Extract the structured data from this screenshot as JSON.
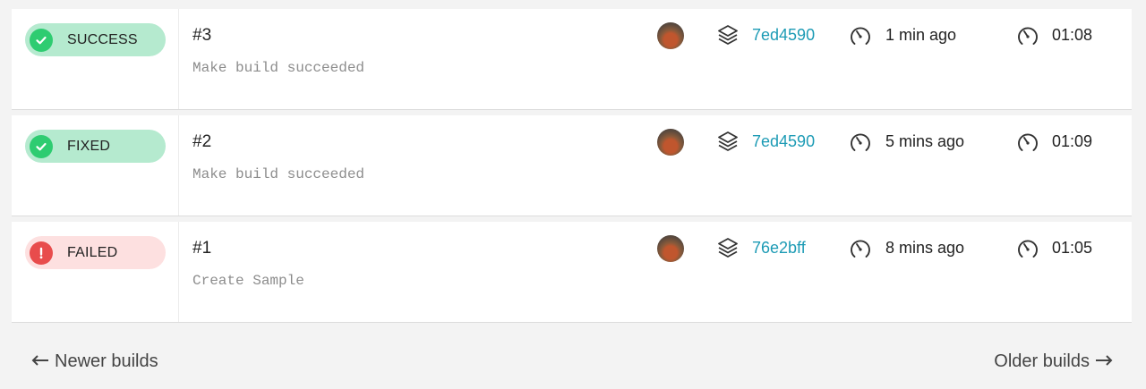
{
  "builds": [
    {
      "status": "SUCCESS",
      "status_kind": "success",
      "number": "#3",
      "message": "Make build succeeded",
      "commit": "7ed4590",
      "created": "1 min ago",
      "duration": "01:08"
    },
    {
      "status": "FIXED",
      "status_kind": "success",
      "number": "#2",
      "message": "Make build succeeded",
      "commit": "7ed4590",
      "created": "5 mins ago",
      "duration": "01:09"
    },
    {
      "status": "FAILED",
      "status_kind": "failure",
      "number": "#1",
      "message": "Create Sample",
      "commit": "76e2bff",
      "created": "8 mins ago",
      "duration": "01:05"
    }
  ],
  "pagination": {
    "newer_label": "Newer builds",
    "older_label": "Older builds"
  },
  "colors": {
    "success_pill": "#b5eacf",
    "success_dot": "#2ecc71",
    "failure_pill": "#fde0e0",
    "failure_dot": "#e84c4c",
    "commit_link": "#1d9bb5"
  },
  "icons": {
    "success": "check-circle-icon",
    "failure": "exclamation-circle-icon",
    "commit": "layers-icon",
    "created": "speedometer-icon",
    "duration": "speedometer-icon",
    "newer": "arrow-left-icon",
    "older": "arrow-right-icon"
  }
}
